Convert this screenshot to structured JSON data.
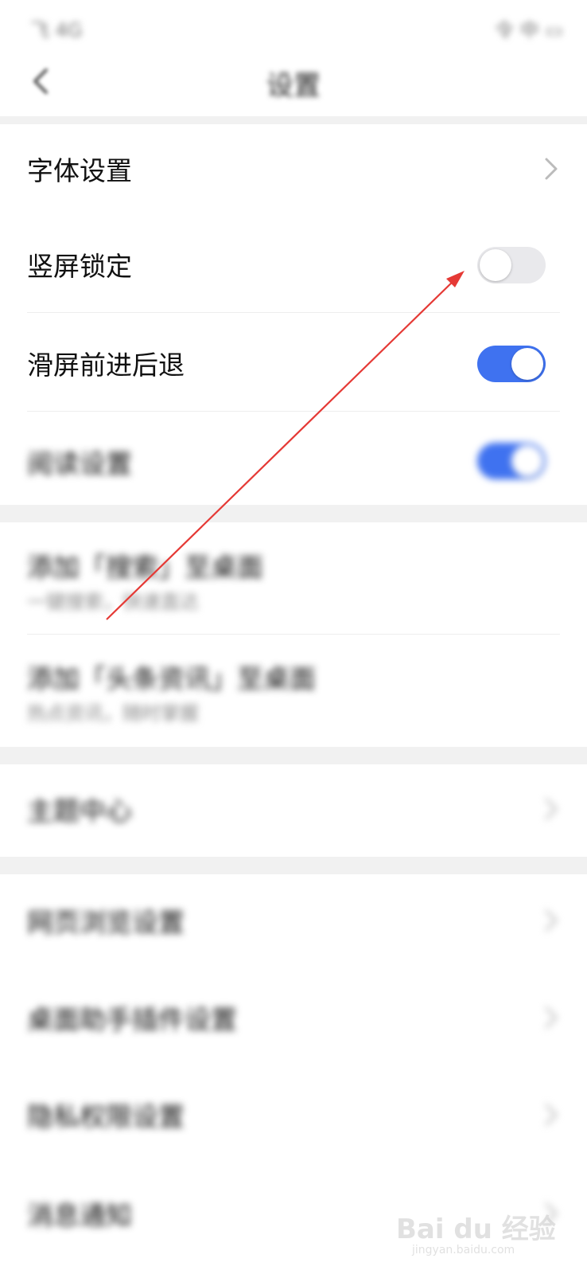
{
  "status_bar": {
    "left": "飞 4G",
    "right": "令 中 ▭"
  },
  "nav": {
    "title": "设置"
  },
  "settings": {
    "font_settings": {
      "label": "字体设置"
    },
    "portrait_lock": {
      "label": "竖屏锁定",
      "enabled": false
    },
    "swipe_nav": {
      "label": "滑屏前进后退",
      "enabled": true
    },
    "row4": {
      "label": "阅读设置",
      "enabled": true
    },
    "add_shortcut_1": {
      "label": "添加「搜索」至桌面",
      "sub": "一键搜索，快速直达"
    },
    "add_shortcut_2": {
      "label": "添加「头条资讯」至桌面",
      "sub": "热点资讯，随时掌握"
    },
    "theme_center": {
      "label": "主题中心"
    },
    "page_browse": {
      "label": "网页浏览设置"
    },
    "desktop_widget": {
      "label": "桌面助手插件设置"
    },
    "privacy": {
      "label": "隐私权限设置"
    },
    "message_notify": {
      "label": "消息通知"
    }
  },
  "watermark": {
    "logo": "Bai du 经验",
    "url": "jingyan.baidu.com"
  },
  "colors": {
    "accent": "#3f72f0",
    "annotation_arrow": "#e53935"
  }
}
